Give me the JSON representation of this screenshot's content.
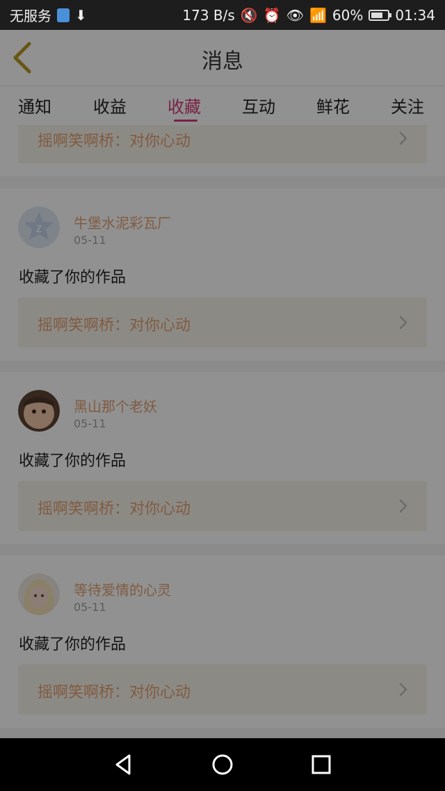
{
  "status_bar": {
    "carrier": "无服务",
    "speed": "173 B/s",
    "battery": "60%",
    "time": "01:34"
  },
  "header": {
    "title": "消息"
  },
  "tabs": [
    {
      "label": "通知",
      "active": false
    },
    {
      "label": "收益",
      "active": false
    },
    {
      "label": "收藏",
      "active": true
    },
    {
      "label": "互动",
      "active": false
    },
    {
      "label": "鲜花",
      "active": false
    },
    {
      "label": "关注",
      "active": false
    }
  ],
  "partial_item": {
    "reference": "摇啊笑啊桥：对你心动"
  },
  "items": [
    {
      "username": "牛堡水泥彩瓦厂",
      "date": "05-11",
      "action": "收藏了你的作品",
      "reference": "摇啊笑啊桥：对你心动"
    },
    {
      "username": "黑山那个老妖",
      "date": "05-11",
      "action": "收藏了你的作品",
      "reference": "摇啊笑啊桥：对你心动"
    },
    {
      "username": "等待爱情的心灵",
      "date": "05-11",
      "action": "收藏了你的作品",
      "reference": "摇啊笑啊桥：对你心动"
    }
  ],
  "colors": {
    "accent": "#d23c78",
    "username": "#e2a172",
    "reference_bg": "#f7f3ea"
  }
}
